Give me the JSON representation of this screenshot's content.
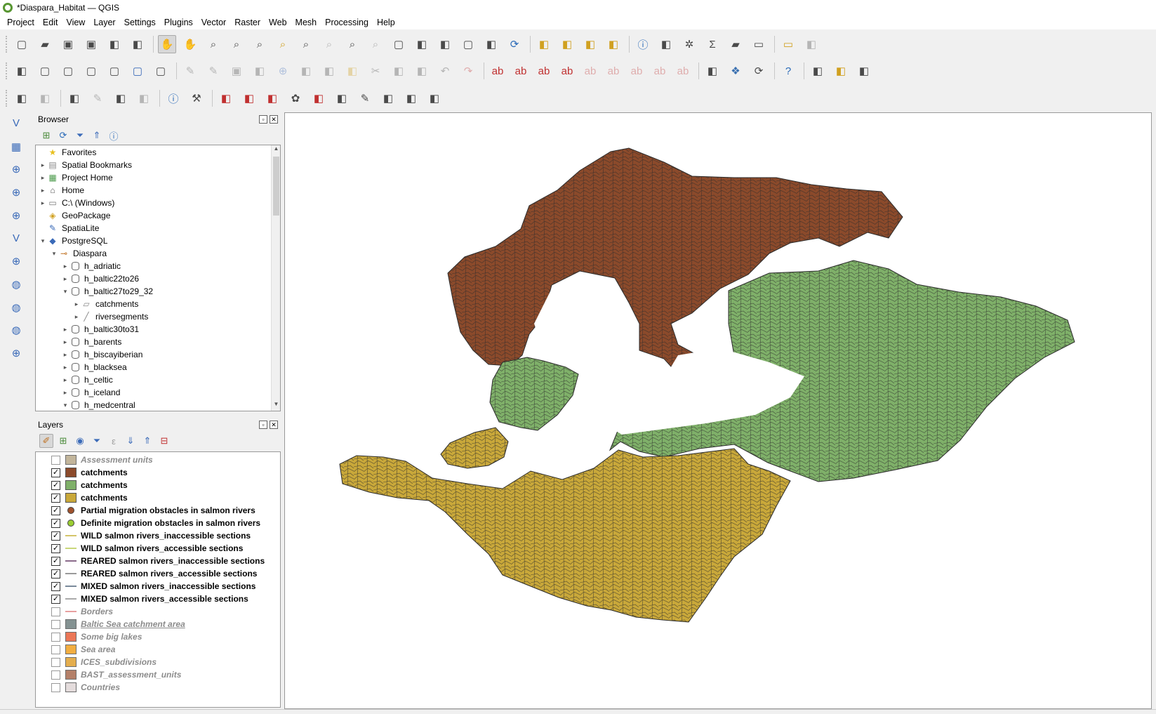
{
  "window": {
    "title": "*Diaspara_Habitat — QGIS"
  },
  "menu": [
    "Project",
    "Edit",
    "View",
    "Layer",
    "Settings",
    "Plugins",
    "Vector",
    "Raster",
    "Web",
    "Mesh",
    "Processing",
    "Help"
  ],
  "icons": {
    "app": "qgis-logo-icon",
    "toolbar1": [
      "new-project-icon",
      "open-project-icon",
      "save-project-icon",
      "save-as-icon",
      "print-layout-icon",
      "style-manager-icon",
      "pan-icon",
      "pan-to-selection-icon",
      "zoom-in-icon",
      "zoom-out-icon",
      "zoom-full-icon",
      "zoom-to-selection-icon",
      "zoom-to-layer-icon",
      "zoom-native-icon",
      "zoom-last-icon",
      "zoom-next-icon",
      "new-bookmark-icon",
      "show-bookmarks-icon",
      "map-tips-icon",
      "new-3d-view-icon",
      "temporal-icon",
      "refresh-icon",
      "select-features-icon",
      "select-by-value-icon",
      "deselect-icon",
      "select-by-location-icon",
      "identify-icon",
      "attribute-table-icon",
      "settings-icon",
      "statistics-icon",
      "open-table-icon",
      "measure-icon",
      "annotation-icon",
      "plugin-icon"
    ],
    "toolbar2": [
      "data-source-manager-icon",
      "new-geopackage-layer-icon",
      "new-shapefile-layer-icon",
      "new-spatialite-layer-icon",
      "new-virtual-layer-icon",
      "new-mesh-layer-icon",
      "new-temp-layer-icon",
      "edit-pencil-icon",
      "toggle-editing-icon",
      "save-edits-icon",
      "digitize-icon",
      "add-polygon-icon",
      "vertex-tool-icon",
      "modify-attributes-icon",
      "delete-selected-icon",
      "cut-icon",
      "copy-icon",
      "paste-icon",
      "undo-icon",
      "redo-icon",
      "label-abc-icon",
      "label-diagram-icon",
      "label-pin-icon",
      "label-highlight-icon",
      "label-move-icon",
      "label-rotate-icon",
      "label-change-icon",
      "label-show-icon",
      "label-hide-icon",
      "grass-icon",
      "python-icon",
      "sync-icon",
      "help-icon",
      "profile-tool-icon",
      "nnjoin-icon",
      "p2-icon"
    ],
    "toolbar3": [
      "georeferencer-icon",
      "coordinate-capture-icon",
      "grid-icon",
      "vertex-edit-icon",
      "shape-digitize-icon",
      "trace-icon",
      "info-icon",
      "wrench-icon",
      "raster-pixel-icon",
      "symbol-red-icon",
      "scatter-red-icon",
      "flower-icon",
      "heatmap-icon",
      "cluster-icon",
      "edit-symbol-icon",
      "gradient-icon",
      "color-bars-icon",
      "color-wheel-icon"
    ],
    "vtoolbar": [
      "add-vector-layer-icon",
      "add-raster-layer-icon",
      "add-mesh-layer-icon",
      "add-delimited-text-icon",
      "add-spatialite-icon",
      "add-vector-tile-icon",
      "add-postgis-icon",
      "add-wms-icon",
      "add-wcs-icon",
      "add-wfs-icon",
      "add-virtual-layer-icon"
    ]
  },
  "browser": {
    "title": "Browser",
    "items": [
      {
        "indent": 0,
        "arrow": "",
        "icon": "star-icon",
        "label": "Favorites"
      },
      {
        "indent": 0,
        "arrow": "▸",
        "icon": "bookmark-icon",
        "label": "Spatial Bookmarks"
      },
      {
        "indent": 0,
        "arrow": "▸",
        "icon": "project-home-icon",
        "label": "Project Home"
      },
      {
        "indent": 0,
        "arrow": "▸",
        "icon": "home-icon",
        "label": "Home"
      },
      {
        "indent": 0,
        "arrow": "▸",
        "icon": "folder-icon",
        "label": "C:\\ (Windows)"
      },
      {
        "indent": 0,
        "arrow": "",
        "icon": "geopackage-icon",
        "label": "GeoPackage"
      },
      {
        "indent": 0,
        "arrow": "",
        "icon": "spatialite-icon",
        "label": "SpatiaLite"
      },
      {
        "indent": 0,
        "arrow": "▾",
        "icon": "postgresql-icon",
        "label": "PostgreSQL"
      },
      {
        "indent": 1,
        "arrow": "▾",
        "icon": "connection-icon",
        "label": "Diaspara"
      },
      {
        "indent": 2,
        "arrow": "▸",
        "icon": "schema-icon",
        "label": "h_adriatic"
      },
      {
        "indent": 2,
        "arrow": "▸",
        "icon": "schema-icon",
        "label": "h_baltic22to26"
      },
      {
        "indent": 2,
        "arrow": "▾",
        "icon": "schema-icon",
        "label": "h_baltic27to29_32"
      },
      {
        "indent": 3,
        "arrow": "▸",
        "icon": "polygon-layer-icon",
        "label": "catchments"
      },
      {
        "indent": 3,
        "arrow": "▸",
        "icon": "line-layer-icon",
        "label": "riversegments"
      },
      {
        "indent": 2,
        "arrow": "▸",
        "icon": "schema-icon",
        "label": "h_baltic30to31"
      },
      {
        "indent": 2,
        "arrow": "▸",
        "icon": "schema-icon",
        "label": "h_barents"
      },
      {
        "indent": 2,
        "arrow": "▸",
        "icon": "schema-icon",
        "label": "h_biscayiberian"
      },
      {
        "indent": 2,
        "arrow": "▸",
        "icon": "schema-icon",
        "label": "h_blacksea"
      },
      {
        "indent": 2,
        "arrow": "▸",
        "icon": "schema-icon",
        "label": "h_celtic"
      },
      {
        "indent": 2,
        "arrow": "▸",
        "icon": "schema-icon",
        "label": "h_iceland"
      },
      {
        "indent": 2,
        "arrow": "▾",
        "icon": "schema-icon",
        "label": "h_medcentral"
      }
    ]
  },
  "layers": {
    "title": "Layers",
    "items": [
      {
        "checked": false,
        "sym": "fill",
        "color": "#b8a98a",
        "label": "Assessment units",
        "underline": false
      },
      {
        "checked": true,
        "sym": "fill",
        "color": "#8b4a2b",
        "label": "catchments",
        "underline": false
      },
      {
        "checked": true,
        "sym": "fill",
        "color": "#7fb069",
        "label": "catchments",
        "underline": false
      },
      {
        "checked": true,
        "sym": "fill",
        "color": "#c9a83a",
        "label": "catchments",
        "underline": false
      },
      {
        "checked": true,
        "sym": "dot",
        "color": "#a0522d",
        "label": "Partial migration obstacles in salmon rivers",
        "underline": false
      },
      {
        "checked": true,
        "sym": "dot",
        "color": "#9acd32",
        "label": "Definite migration obstacles in salmon rivers",
        "underline": false
      },
      {
        "checked": true,
        "sym": "line",
        "color": "#d4c56a",
        "label": "WILD salmon rivers_inaccessible sections",
        "underline": false
      },
      {
        "checked": true,
        "sym": "line",
        "color": "#c9d77a",
        "label": "WILD salmon rivers_accessible sections",
        "underline": false
      },
      {
        "checked": true,
        "sym": "line",
        "color": "#8b6b8b",
        "label": "REARED salmon rivers_inaccessible sections",
        "underline": false
      },
      {
        "checked": true,
        "sym": "line",
        "color": "#9a9a9a",
        "label": "REARED salmon rivers_accessible sections",
        "underline": false
      },
      {
        "checked": true,
        "sym": "line",
        "color": "#7a8a9a",
        "label": "MIXED salmon rivers_inaccessible sections",
        "underline": false
      },
      {
        "checked": true,
        "sym": "line",
        "color": "#aaaaaa",
        "label": "MIXED salmon rivers_accessible sections",
        "underline": false
      },
      {
        "checked": false,
        "sym": "line",
        "color": "#e8a0a0",
        "label": "Borders",
        "underline": false
      },
      {
        "checked": false,
        "sym": "fill",
        "color": "#6f7f80",
        "label": "Baltic Sea catchment area",
        "underline": true
      },
      {
        "checked": false,
        "sym": "fill",
        "color": "#e8603a",
        "label": "Some big lakes",
        "underline": false
      },
      {
        "checked": false,
        "sym": "fill",
        "color": "#f0a020",
        "label": "Sea area",
        "underline": false
      },
      {
        "checked": false,
        "sym": "fill",
        "color": "#e0a030",
        "label": "ICES_subdivisions",
        "underline": false
      },
      {
        "checked": false,
        "sym": "fill",
        "color": "#a86a50",
        "label": "BAST_assessment_units",
        "underline": false
      },
      {
        "checked": false,
        "sym": "fill",
        "color": "#e0d6d6",
        "label": "Countries",
        "underline": false
      }
    ]
  },
  "map": {
    "colors": {
      "north": "#8b4a2b",
      "east": "#7fb069",
      "south": "#c9a83a",
      "outline": "#2b2b2b",
      "water": "#ffffff"
    }
  }
}
